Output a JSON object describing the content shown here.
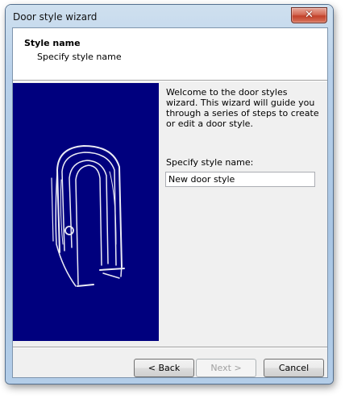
{
  "window": {
    "title": "Door style wizard",
    "close_glyph": "✕"
  },
  "header": {
    "title": "Style name",
    "subtitle": "Specify style name"
  },
  "image": {
    "icon": "door-sketch",
    "background": "#00007e"
  },
  "content": {
    "welcome_text": "Welcome to the door styles wizard. This wizard will guide you through a series of steps to create or edit a door style.",
    "name_label": "Specify style name:",
    "name_value": "New door style"
  },
  "buttons": {
    "back": "< Back",
    "next": "Next >",
    "cancel": "Cancel"
  }
}
